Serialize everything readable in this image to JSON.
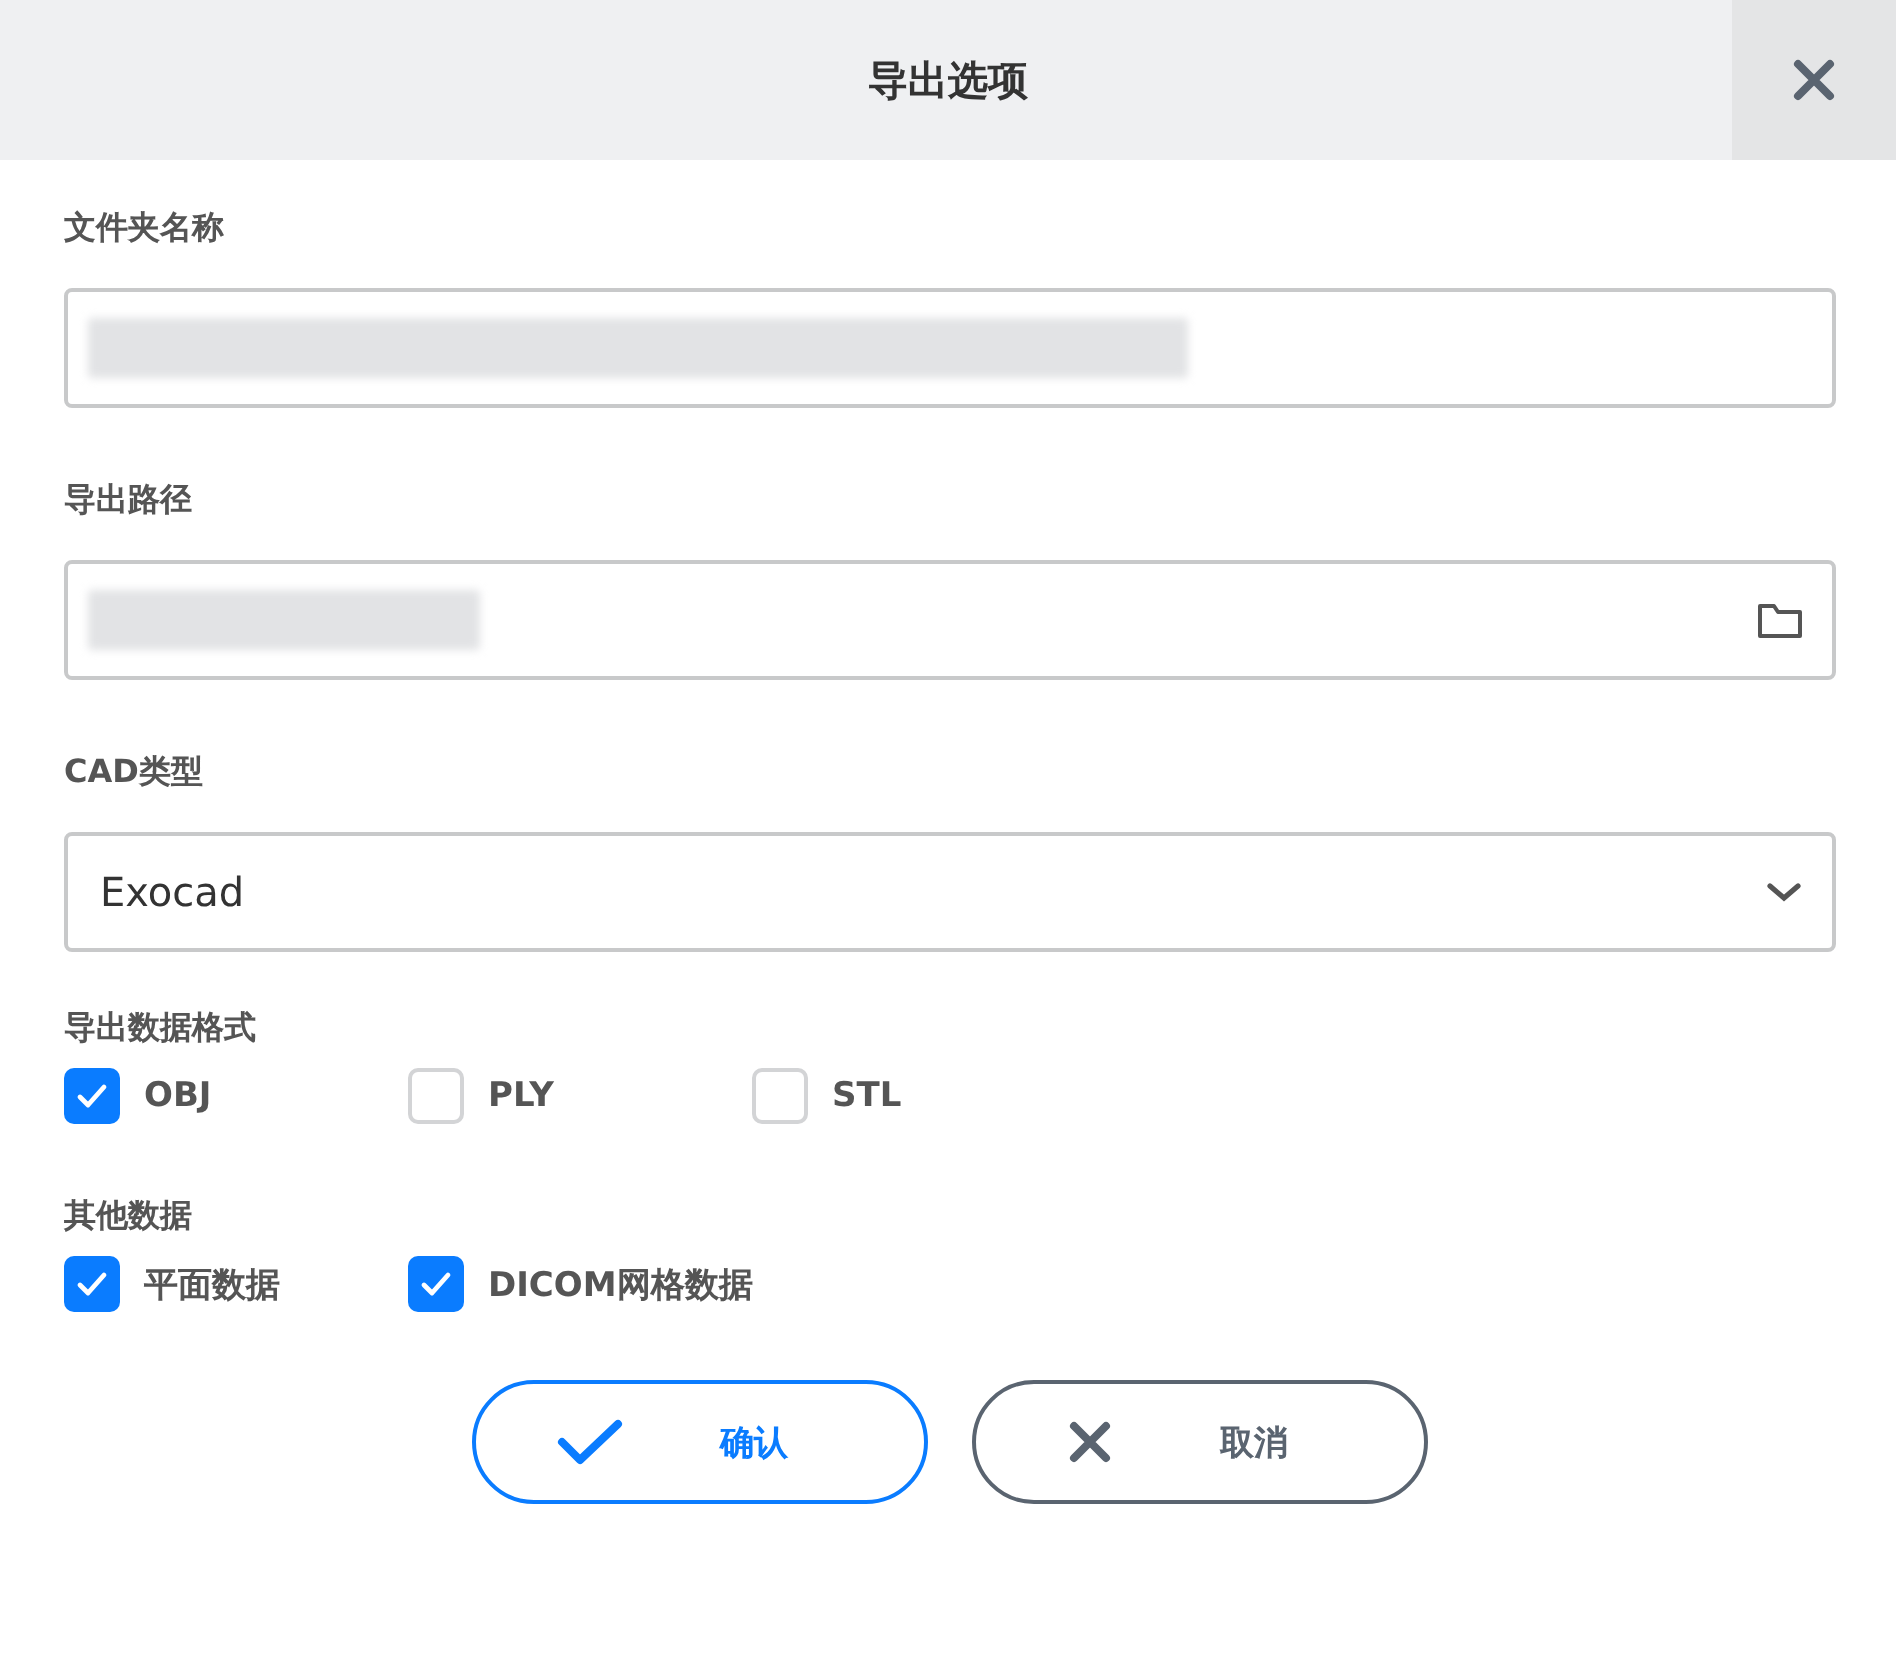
{
  "dialog": {
    "title": "导出选项"
  },
  "fields": [
    {
      "label": "文件夹名称",
      "kind": "text"
    },
    {
      "label": "导出路径",
      "kind": "path"
    },
    {
      "label": "CAD类型",
      "kind": "select",
      "value": "Exocad"
    }
  ],
  "groups": [
    {
      "label": "导出数据格式",
      "options": [
        {
          "label": "OBJ",
          "checked": true
        },
        {
          "label": "PLY",
          "checked": false
        },
        {
          "label": "STL",
          "checked": false
        }
      ]
    },
    {
      "label": "其他数据",
      "options": [
        {
          "label": "平面数据",
          "checked": true
        },
        {
          "label": "DICOM网格数据",
          "checked": true
        }
      ]
    }
  ],
  "buttons": [
    {
      "label": "确认",
      "kind": "confirm"
    },
    {
      "label": "取消",
      "kind": "cancel"
    }
  ]
}
